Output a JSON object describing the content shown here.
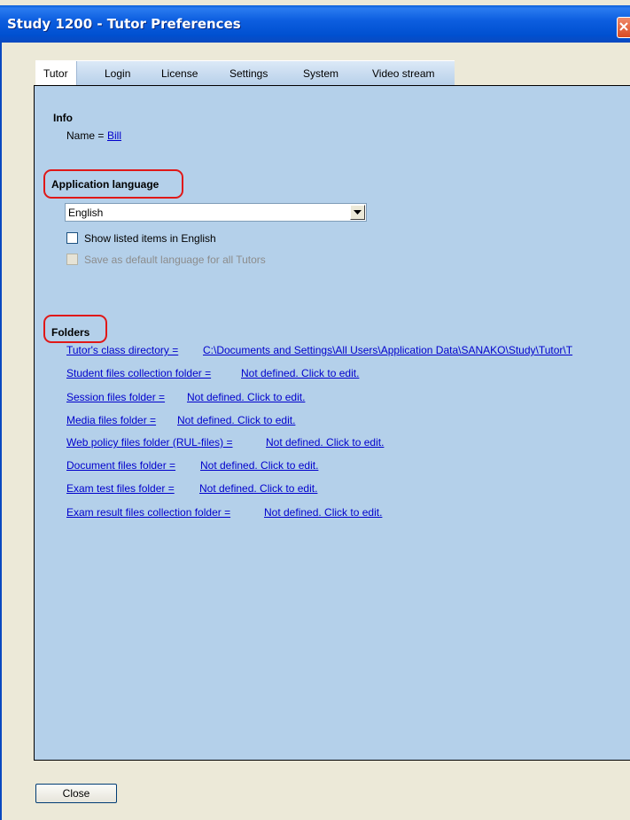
{
  "window": {
    "title": "Study 1200 - Tutor Preferences"
  },
  "tabs": [
    "Tutor",
    "Login",
    "License",
    "Settings",
    "System",
    "Video stream"
  ],
  "info": {
    "heading": "Info",
    "name_label": "Name =",
    "name_value": "Bill"
  },
  "language": {
    "heading": "Application language",
    "selected": "English",
    "show_english_label": "Show listed items in English",
    "save_default_label": "Save as default language for all Tutors"
  },
  "folders": {
    "heading": "Folders",
    "items": [
      {
        "label": "Tutor's class directory =",
        "value": "C:\\Documents and Settings\\All Users\\Application Data\\SANAKO\\Study\\Tutor\\T"
      },
      {
        "label": "Student files collection folder =",
        "value": "Not defined. Click to edit."
      },
      {
        "label": "Session files folder =",
        "value": "Not defined. Click to edit."
      },
      {
        "label": "Media files folder =",
        "value": "Not defined. Click to edit."
      },
      {
        "label": "Web policy files folder (RUL-files) =",
        "value": "Not defined. Click to edit."
      },
      {
        "label": "Document files folder =",
        "value": "Not defined. Click to edit."
      },
      {
        "label": "Exam test files folder =",
        "value": "Not defined. Click to edit."
      },
      {
        "label": "Exam result files collection folder =",
        "value": "Not defined. Click to edit."
      }
    ]
  },
  "buttons": {
    "close": "Close"
  },
  "colors": {
    "panel": "#b4d0ea",
    "link": "#0000cc",
    "highlight": "#e01818",
    "titlebar": "#0050d0"
  }
}
